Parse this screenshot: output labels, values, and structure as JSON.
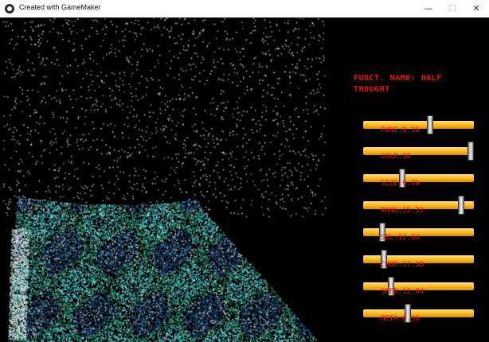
{
  "window": {
    "title": "Created with GameMaker",
    "minimize": "—",
    "maximize": "☐",
    "close": "✕"
  },
  "panel": {
    "title": "FUNCT. NAME: HALF\nTHOUGHT",
    "sliders": [
      {
        "label": "FUNC:0.36",
        "value": 0.61
      },
      {
        "label": "COLR:30",
        "value": 1.0
      },
      {
        "label": "SIZE:6.70",
        "value": 0.34
      },
      {
        "label": "RANG:15.33",
        "value": 0.91
      },
      {
        "label": "SEL:12.84",
        "value": 0.15
      },
      {
        "label": "CHOR:17.38",
        "value": 0.17
      },
      {
        "label": "SPED:12.84",
        "value": 0.24
      },
      {
        "label": "META:0.38",
        "value": 0.4
      }
    ]
  }
}
